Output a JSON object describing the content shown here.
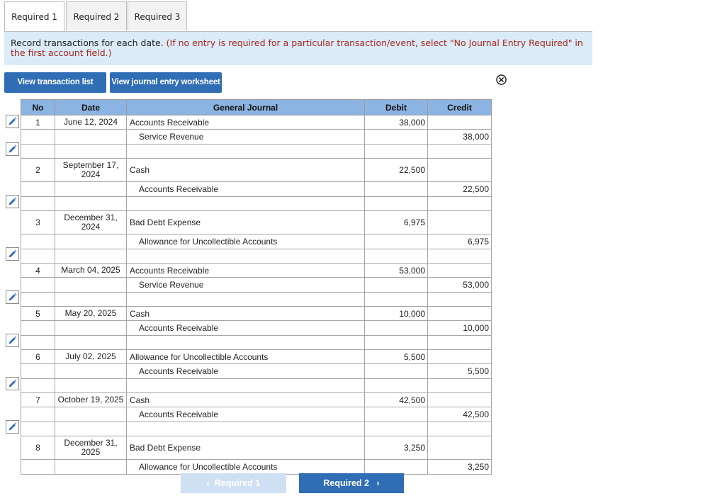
{
  "tabs": [
    "Required 1",
    "Required 2",
    "Required 3"
  ],
  "instructions": {
    "main": "Record transactions for each date. ",
    "note": "(If no entry is required for a particular transaction/event, select \"No Journal Entry Required\" in the first account field.)"
  },
  "buttons": {
    "view_transactions": "View transaction list",
    "view_worksheet": "View journal entry worksheet"
  },
  "table": {
    "headers": {
      "no": "No",
      "date": "Date",
      "journal": "General Journal",
      "debit": "Debit",
      "credit": "Credit"
    },
    "entries": [
      {
        "no": "1",
        "date": "June 12, 2024",
        "debit_account": "Accounts Receivable",
        "debit": "38,000",
        "credit_account": "Service Revenue",
        "credit": "38,000"
      },
      {
        "no": "2",
        "date": "September 17, 2024",
        "debit_account": "Cash",
        "debit": "22,500",
        "credit_account": "Accounts Receivable",
        "credit": "22,500"
      },
      {
        "no": "3",
        "date": "December 31, 2024",
        "debit_account": "Bad Debt Expense",
        "debit": "6,975",
        "credit_account": "Allowance for Uncollectible Accounts",
        "credit": "6,975"
      },
      {
        "no": "4",
        "date": "March 04, 2025",
        "debit_account": "Accounts Receivable",
        "debit": "53,000",
        "credit_account": "Service Revenue",
        "credit": "53,000"
      },
      {
        "no": "5",
        "date": "May 20, 2025",
        "debit_account": "Cash",
        "debit": "10,000",
        "credit_account": "Accounts Receivable",
        "credit": "10,000"
      },
      {
        "no": "6",
        "date": "July 02, 2025",
        "debit_account": "Allowance for Uncollectible Accounts",
        "debit": "5,500",
        "credit_account": "Accounts Receivable",
        "credit": "5,500"
      },
      {
        "no": "7",
        "date": "October 19, 2025",
        "debit_account": "Cash",
        "debit": "42,500",
        "credit_account": "Accounts Receivable",
        "credit": "42,500"
      },
      {
        "no": "8",
        "date": "December 31, 2025",
        "debit_account": "Bad Debt Expense",
        "debit": "3,250",
        "credit_account": "Allowance for Uncollectible Accounts",
        "credit": "3,250"
      }
    ]
  },
  "nav": {
    "prev": "Required 1",
    "next": "Required 2"
  },
  "icons": {
    "edit": "pencil-icon",
    "close": "close-circle-icon",
    "prev": "chevron-left-icon",
    "next": "chevron-right-icon"
  },
  "colors": {
    "accent": "#2f6db5",
    "header": "#8cb4e2",
    "instruction_bg": "#dcebf8",
    "note_text": "#a6261e"
  }
}
